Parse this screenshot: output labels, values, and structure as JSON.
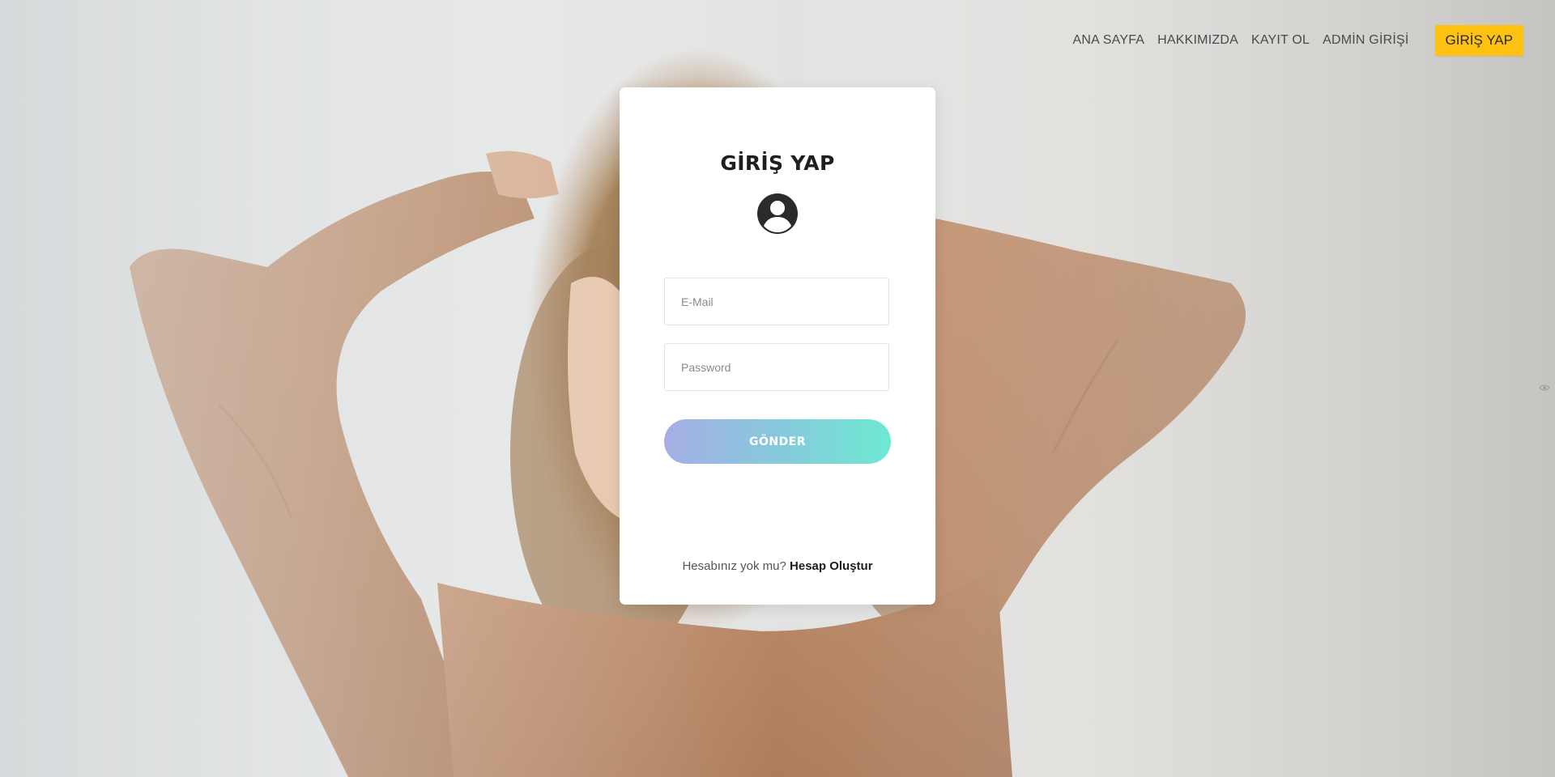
{
  "nav": {
    "items": [
      {
        "label": "ANA SAYFA"
      },
      {
        "label": "HAKKIMIZDA"
      },
      {
        "label": "KAYIT OL"
      },
      {
        "label": "ADMİN GİRİŞİ"
      }
    ],
    "cta_label": "GİRİŞ YAP",
    "cta_color": "#ffc211"
  },
  "login": {
    "title": "GİRİŞ YAP",
    "icon": "user-circle-icon",
    "email_placeholder": "E-Mail",
    "password_placeholder": "Password",
    "submit_label": "GÖNDER",
    "footer_text": "Hesabınız yok mu?",
    "footer_link": "Hesap Oluştur"
  },
  "colors": {
    "button_gradient_start": "#a6aee5",
    "button_gradient_end": "#6ee9d2",
    "card_background": "#ffffff"
  }
}
